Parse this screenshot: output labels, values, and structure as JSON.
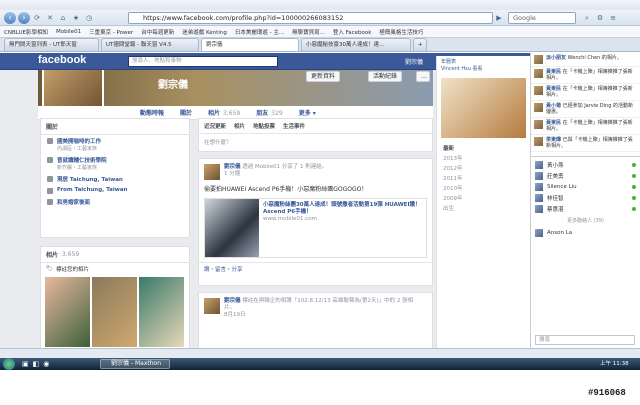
{
  "browser": {
    "url": "https://www.facebook.com/profile.php?id=100000266083152",
    "search_label": "Google",
    "bookmarks": [
      "CNBLUE影學相知",
      "Mobile01",
      "三重東京 - Power",
      "台中每週更新",
      "迷弟遊戲 Kenting",
      "日本美麗環遊 - 主...",
      "無聊寶貝寫...",
      "登入 Facebook",
      "極簡風格生活技巧",
      "使用的版...",
      "重作的历史 (1)"
    ],
    "tabs": [
      {
        "label": "無門鬧天窗列表 - UT郎天窗"
      },
      {
        "label": "UT德問堂報 - 聯天窗 V4.5"
      },
      {
        "label": "劉宗儀",
        "active": true
      },
      {
        "label": "小惡魔秘技豪30萬人達成！達..."
      }
    ]
  },
  "facebook": {
    "logo": "facebook",
    "search_placeholder": "搜尋人、地點和事物",
    "user_name": "劉宗儀",
    "home_label": "首頁",
    "profile": {
      "name": "劉宗儀",
      "update_info": "更新資料",
      "activity_log": "活動紀錄",
      "tabs": [
        {
          "label": "動態時報",
          "count": ""
        },
        {
          "label": "關於",
          "count": ""
        },
        {
          "label": "相片",
          "count": "3,659"
        },
        {
          "label": "朋友",
          "count": "329"
        },
        {
          "label": "更多",
          "count": ""
        }
      ]
    },
    "about": {
      "title": "關於",
      "items": [
        {
          "text": "國美開咖啡的工作",
          "sub": "內湖區・工藝家族"
        },
        {
          "text": "曾就讀輔仁技術學院",
          "sub": "新竹縣・工藝家族"
        },
        {
          "text": "現居 Taichung, Taiwan",
          "sub": ""
        },
        {
          "text": "From Taichung, Taiwan",
          "sub": ""
        },
        {
          "text": "和男婚家後面",
          "sub": ""
        }
      ]
    },
    "photos": {
      "title": "相片",
      "count": "3,659",
      "tagged": "標註您的相片"
    },
    "composer": {
      "tabs": [
        "近況更新",
        "相片",
        "地點投票",
        "生活事件"
      ],
      "placeholder": "在想什麼？"
    },
    "post1": {
      "author": "劉宗儀",
      "action": "透過 Mobile01 分享了 1 則連結。",
      "time": "1 分鐘",
      "text": "偷要拍HUAWEI Ascend P6手機！小惡魔粉絲團GOGOGO！",
      "link_title": "小惡魔粉絲團30萬人達成！頭號撒者活動第19彈 HUAWEI讚！Ascend P6手機！",
      "link_domain": "www.mobile01.com",
      "actions": "讚・留言・分享"
    },
    "post2": {
      "author": "劉宗儀",
      "action": "標註在與韓企的相簿「102.8.12/13 高雄聯賢為(第2天)」中的 2 張相片。",
      "time": "8月19日"
    },
    "rightcol": {
      "items": [
        "年曆表",
        "Vincent Hsu 看看",
        "2013年"
      ],
      "years": [
        "最新",
        "2013年",
        "2012年",
        "2011年",
        "2010年",
        "2009年",
        "出生"
      ]
    },
    "ticker": [
      {
        "name": "淡小朋友",
        "text": "Wenchi Chen 的相片。"
      },
      {
        "name": "黃東民",
        "text": "在「卡機上陣」相簿推推了張新相片。"
      },
      {
        "name": "黃東民",
        "text": "在「卡機上陣」相簿推推了張新相片。"
      },
      {
        "name": "黃小菊",
        "text": "已經參加 Jarvie Ding 的活動新優惠。"
      },
      {
        "name": "黃東民",
        "text": "在「卡機上陣」相簿推推了張新相片。"
      },
      {
        "name": "茶東燁",
        "text": "已與「卡機上陣」相簿推推了張新相片。"
      }
    ],
    "chat": {
      "title": "更多聯絡人",
      "people": [
        "黃小燕",
        "莊美勇",
        "Silence Liu",
        "林佳智",
        "蔡惠湛"
      ],
      "more_header": "更多聯絡人 (39)",
      "extra": "Anson La",
      "search": "搜尋"
    }
  },
  "taskbar": {
    "app_label": "劉宗儀 - Maxthon",
    "time": "上午 11:38"
  },
  "watermark": "#916068",
  "colors": {
    "fb_blue": "#3b5998",
    "link": "#365899"
  }
}
